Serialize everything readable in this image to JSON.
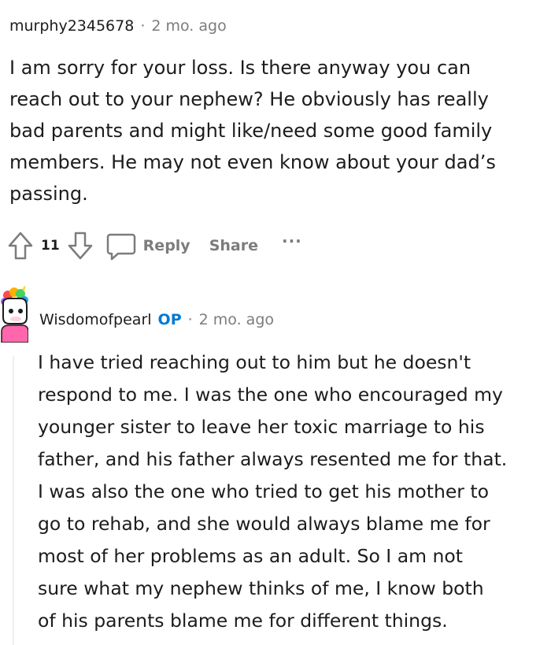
{
  "comments": [
    {
      "username": "murphy2345678",
      "separator": "·",
      "time": "2 mo. ago",
      "body": "I am sorry for your loss. Is there anyway you can\nreach out to your nephew? He obviously has really\nbad parents and might like/need some good family\nmembers. He may not even know about your dad’s\npassing.",
      "votes": "11",
      "reply_label": "Reply",
      "share_label": "Share",
      "more_label": "···"
    },
    {
      "username": "Wisdomofpearl",
      "op_badge": "OP",
      "separator": "·",
      "time": "2 mo. ago",
      "body": "I have tried reaching out to him but he doesn't\nrespond to me. I was the one who encouraged my\nyounger sister to leave her toxic marriage to his\nfather, and his father always resented me for that.\nI was also the one who tried to get his mother to\ngo to rehab, and she would always blame me for\nmost of her problems as an adult. So I am not\nsure what my nephew thinks of me, I know both\nof his parents blame me for different things."
    }
  ],
  "icons": {
    "upvote": "arrow-up-icon",
    "downvote": "arrow-down-icon",
    "reply": "speech-bubble-icon",
    "avatar": "unicorn-avatar-icon"
  },
  "colors": {
    "text": "#1c1c1c",
    "meta": "#7c7c7c",
    "op": "#0079d3",
    "thread_line": "#edeff1"
  }
}
